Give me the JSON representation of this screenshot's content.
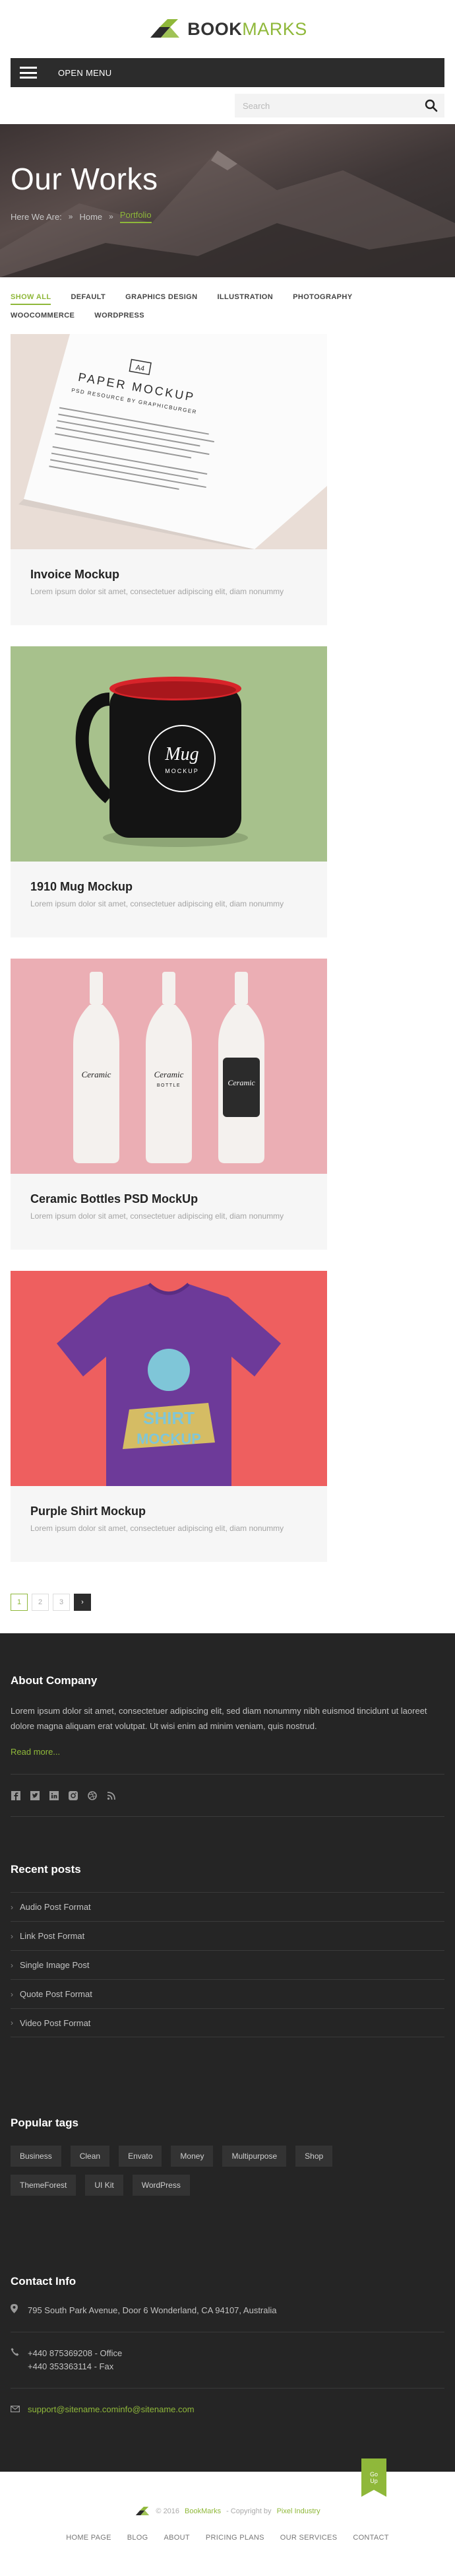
{
  "brand": {
    "name_bold": "BOOK",
    "name_light": "MARKS",
    "accent": "#8fb83a"
  },
  "menu": {
    "label": "OPEN MENU"
  },
  "search": {
    "placeholder": "Search"
  },
  "hero": {
    "title": "Our Works",
    "breadcrumb": [
      "Here We Are:",
      "Home",
      "Portfolio"
    ]
  },
  "filters": [
    "Show All",
    "Default",
    "Graphics Design",
    "Illustration",
    "Photography",
    "WooCommerce",
    "WordPress"
  ],
  "works": [
    {
      "title": "Invoice Mockup",
      "text": "Lorem ipsum dolor sit amet, consectetuer adipiscing elit, diam nonummy",
      "image": "paper-mockup",
      "image_text": {
        "tag": "A4",
        "title": "PAPER MOCKUP",
        "sub": "PSD RESOURCE BY GRAPHICBURGER"
      }
    },
    {
      "title": "1910 Mug Mockup",
      "text": "Lorem ipsum dolor sit amet, consectetuer adipiscing elit, diam nonummy",
      "image": "mug-mockup",
      "image_text": {
        "title": "Mug",
        "sub": "MOCKUP"
      }
    },
    {
      "title": "Ceramic Bottles PSD MockUp",
      "text": "Lorem ipsum dolor sit amet, consectetuer adipiscing elit, diam nonummy",
      "image": "bottles-mockup",
      "image_text": {
        "title": "Ceramic",
        "sub": "BOTTLE"
      }
    },
    {
      "title": "Purple Shirt Mockup",
      "text": "Lorem ipsum dolor sit amet, consectetuer adipiscing elit, diam nonummy",
      "image": "shirt-mockup",
      "image_text": {
        "title": "SHIRT",
        "sub": "MOCKUP"
      }
    }
  ],
  "pagination": {
    "pages": [
      "1",
      "2",
      "3"
    ],
    "current": "1",
    "next": "›"
  },
  "footer": {
    "about": {
      "title": "About Company",
      "text": "Lorem ipsum dolor sit amet, consectetuer adipiscing elit, sed diam nonummy nibh euismod tincidunt ut laoreet dolore magna aliquam erat volutpat. Ut wisi enim ad minim veniam, quis nostrud.",
      "read_more": "Read more..."
    },
    "social": [
      "facebook-icon",
      "twitter-icon",
      "linkedin-icon",
      "instagram-icon",
      "dribbble-icon",
      "rss-icon"
    ],
    "recent_posts": {
      "title": "Recent posts",
      "items": [
        "Audio Post Format",
        "Link Post Format",
        "Single Image Post",
        "Quote Post Format",
        "Video Post Format"
      ]
    },
    "tags": {
      "title": "Popular tags",
      "items": [
        "Business",
        "Clean",
        "Envato",
        "Money",
        "Multipurpose",
        "Shop",
        "ThemeForest",
        "UI Kit",
        "WordPress"
      ]
    },
    "contact": {
      "title": "Contact Info",
      "address": "795 South Park Avenue, Door 6 Wonderland, CA 94107, Australia",
      "phone": "+440 875369208 - Office",
      "fax": "+440 353363114 - Fax",
      "email": "support@sitename.cominfo@sitename.com"
    }
  },
  "bottom": {
    "back_top": [
      "Go",
      "Up"
    ],
    "copyright_prefix": "© 2016",
    "copyright_brand": "BookMarks",
    "copyright_mid": "- Copyright by",
    "copyright_author": "Pixel Industry",
    "nav": [
      "Home Page",
      "Blog",
      "About",
      "Pricing Plans",
      "Our Services",
      "Contact"
    ]
  }
}
